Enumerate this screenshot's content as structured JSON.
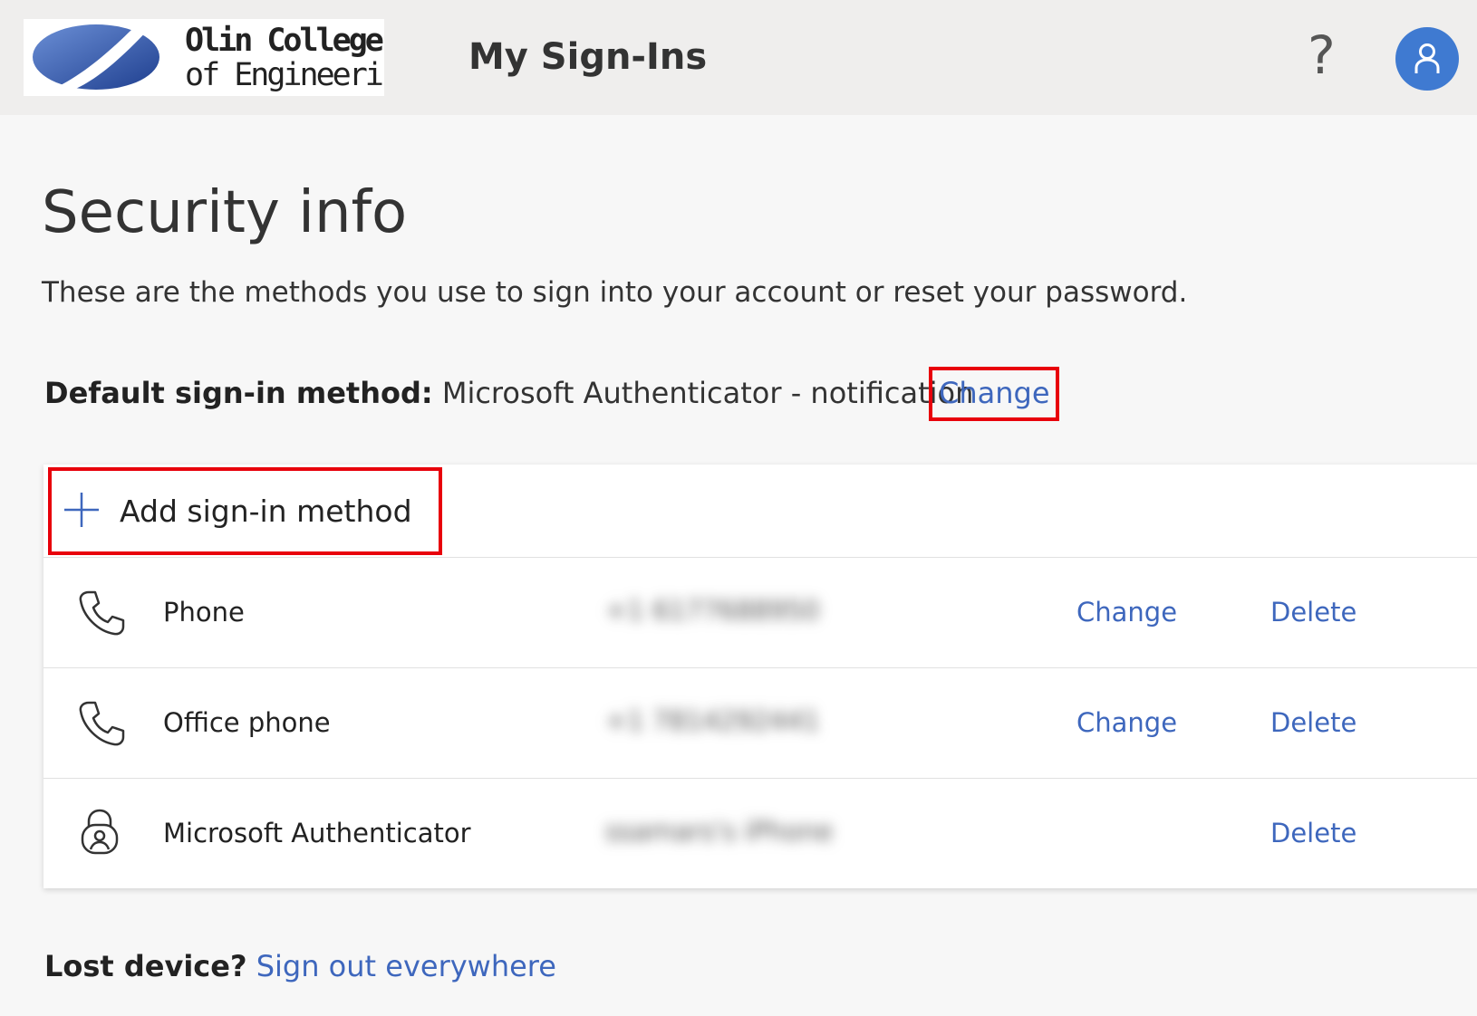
{
  "header": {
    "logo_line1": "Olin College",
    "logo_line2": "of Engineering",
    "app_title": "My Sign-Ins",
    "help_glyph": "?",
    "accent": "#3f7ad1"
  },
  "main": {
    "title": "Security info",
    "description": "These are the methods you use to sign into your account or reset your password.",
    "default_label": "Default sign-in method:",
    "default_value": "Microsoft Authenticator - notification",
    "default_change": "Change",
    "add_method_label": "Add sign-in method",
    "methods": [
      {
        "icon": "phone-icon",
        "name": "Phone",
        "detail": "+1 6177688950",
        "change": "Change",
        "delete": "Delete"
      },
      {
        "icon": "phone-icon",
        "name": "Office phone",
        "detail": "+1 7814292441",
        "change": "Change",
        "delete": "Delete"
      },
      {
        "icon": "authenticator-icon",
        "name": "Microsoft Authenticator",
        "detail": "ssamars's iPhone",
        "change": "",
        "delete": "Delete"
      }
    ],
    "lost_label": "Lost device?",
    "lost_link": "Sign out everywhere",
    "link_color": "#3e67bd",
    "highlight_color": "#e8000b"
  }
}
